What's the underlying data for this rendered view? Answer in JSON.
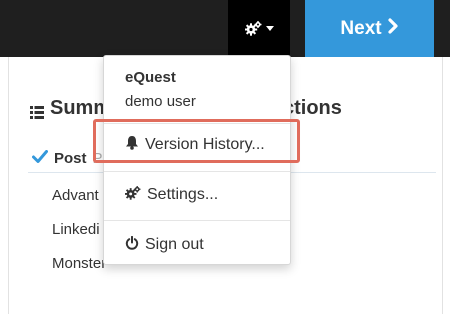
{
  "topbar": {
    "next_label": "Next",
    "accent_color": "#3498db",
    "gear_icon": "gears-icon",
    "caret_icon": "caret-down-icon",
    "next_icon": "chevron-right-icon"
  },
  "main": {
    "heading_start": "Summ",
    "heading_end": "ctions",
    "tab_active": "Post",
    "tab_next": "P",
    "rows": [
      "Advant",
      "Linkedi",
      "Monster"
    ]
  },
  "dropdown": {
    "user_name": "eQuest",
    "user_role": "demo user",
    "items": [
      {
        "label": "Version History...",
        "icon": "bell-icon",
        "highlighted": true
      },
      {
        "label": "Settings...",
        "icon": "gears-icon"
      },
      {
        "label": "Sign out",
        "icon": "power-icon"
      }
    ],
    "highlight_color": "#e06c5c"
  }
}
